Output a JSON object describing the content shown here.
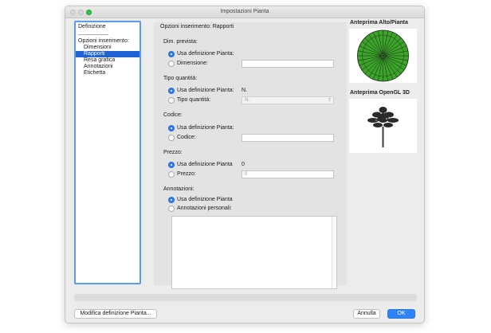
{
  "window": {
    "title": "Impostazioni Pianta"
  },
  "sidebar": {
    "header": "Definizione",
    "separator": "-------------------",
    "group_label": "Opzioni inserimento:",
    "items": [
      {
        "label": "Dimensioni"
      },
      {
        "label": "Rapporti"
      },
      {
        "label": "Resa grafica"
      },
      {
        "label": "Annotazioni"
      },
      {
        "label": "Etichetta"
      }
    ]
  },
  "main": {
    "title": "Opzioni inserimento: Rapporti",
    "dim": {
      "label": "Dim. prevista:",
      "opt_default": "Usa definizione Pianta:",
      "opt_custom": "Dimensione:"
    },
    "qty": {
      "label": "Tipo quantità:",
      "opt_default": "Usa definizione Pianta:",
      "default_value": "N.",
      "opt_custom": "Tipo quantità:",
      "select_value": "N."
    },
    "code": {
      "label": "Codice:",
      "opt_default": "Usa definizione Pianta:",
      "opt_custom": "Codice:"
    },
    "price": {
      "label": "Prezzo:",
      "opt_default": "Usa definizione Pianta",
      "default_value": "0",
      "opt_custom": "Prezzo:",
      "placeholder": "0"
    },
    "notes": {
      "label": "Annotazioni:",
      "opt_default": "Usa definizione Pianta",
      "opt_custom": "Annotazioni personali:"
    }
  },
  "preview": {
    "top_label": "Anteprima Alto/Pianta",
    "opengl_label": "Anteprima OpenGL 3D",
    "plan_color": "#3aa528"
  },
  "buttons": {
    "edit_definition": "Modifica definizione Pianta...",
    "cancel": "Annulla",
    "ok": "OK"
  }
}
